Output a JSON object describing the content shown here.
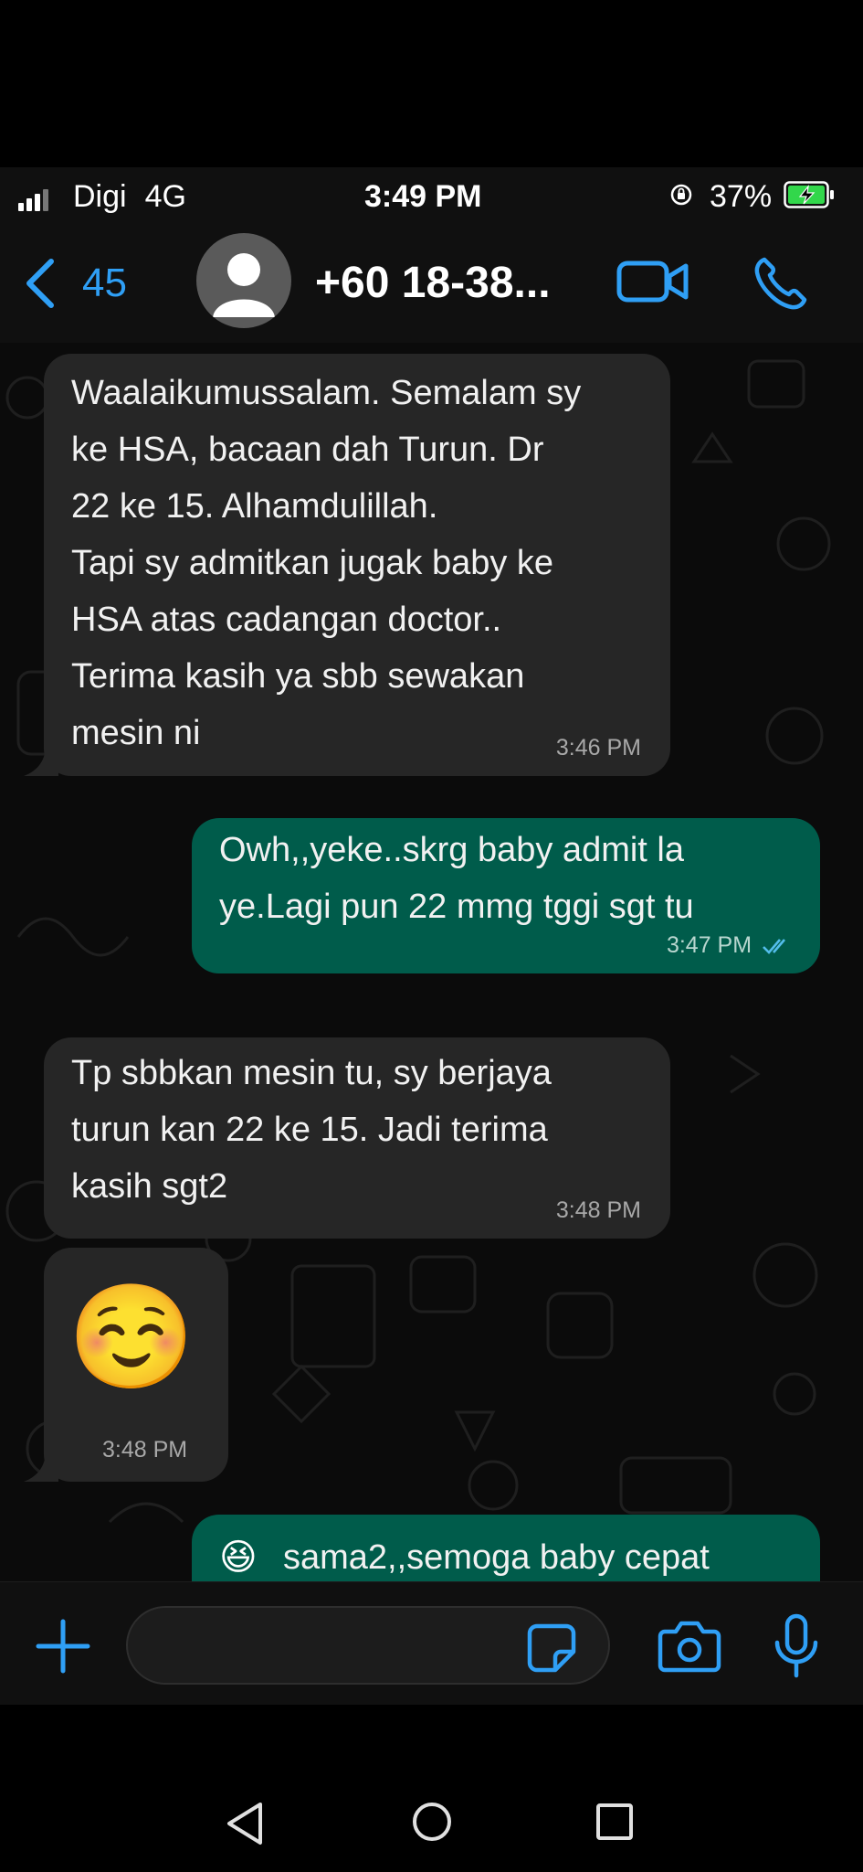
{
  "status_bar": {
    "carrier": "Digi",
    "network": "4G",
    "time": "3:49 PM",
    "battery_percent": "37%",
    "icons": [
      "signal-icon",
      "orientation-lock-icon",
      "battery-charging-icon"
    ]
  },
  "header": {
    "back_count": "45",
    "contact_name": "+60 18-38...",
    "icons": [
      "back-chevron-icon",
      "avatar-placeholder-icon",
      "video-call-icon",
      "phone-call-icon"
    ]
  },
  "messages": [
    {
      "direction": "incoming",
      "text": "Waalaikumussalam. Semalam sy\nke HSA, bacaan dah Turun. Dr\n22 ke 15. Alhamdulillah.\nTapi sy admitkan jugak baby ke\nHSA atas cadangan doctor..\nTerima kasih ya sbb sewakan\nmesin ni",
      "time": "3:46 PM"
    },
    {
      "direction": "outgoing",
      "text": "Owh,,yeke..skrg baby admit la\nye.Lagi pun 22 mmg tggi sgt tu",
      "time": "3:47 PM",
      "status": "read"
    },
    {
      "direction": "incoming",
      "text": "Tp sbbkan mesin tu, sy berjaya\nturun kan 22 ke 15. Jadi terima\nkasih sgt2",
      "time": "3:48 PM"
    },
    {
      "direction": "incoming",
      "emoji": "☺️",
      "time": "3:48 PM"
    },
    {
      "direction": "outgoing",
      "text": "sama2,,semoga baby cepat",
      "leading_emoji": "😆"
    }
  ],
  "input_bar": {
    "placeholder": "",
    "icons": [
      "plus-icon",
      "sticker-icon",
      "camera-icon",
      "microphone-icon"
    ]
  },
  "colors": {
    "accent": "#2f9ff5",
    "incoming_bubble": "#262626",
    "outgoing_bubble": "#005c4b",
    "chat_background": "#0b0b0b",
    "read_receipt": "#53bdeb"
  }
}
